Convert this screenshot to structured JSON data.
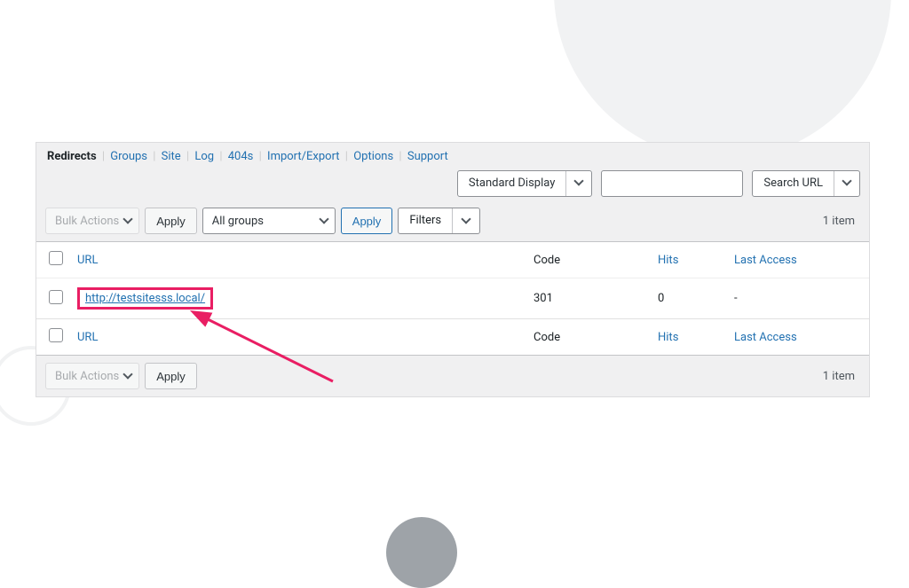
{
  "tabs": {
    "items": [
      "Redirects",
      "Groups",
      "Site",
      "Log",
      "404s",
      "Import/Export",
      "Options",
      "Support"
    ],
    "active_index": 0
  },
  "top_controls": {
    "display_mode": "Standard Display",
    "search_value": "",
    "search_button": "Search URL"
  },
  "toolbar": {
    "bulk_actions_label": "Bulk Actions",
    "apply_label": "Apply",
    "groups_select": "All groups",
    "filters_label": "Filters",
    "item_count": "1 item"
  },
  "table": {
    "headers": {
      "url": "URL",
      "code": "Code",
      "hits": "Hits",
      "last_access": "Last Access"
    },
    "rows": [
      {
        "url": "http://testsitesss.local/",
        "code": "301",
        "hits": "0",
        "last_access": "-"
      }
    ]
  }
}
